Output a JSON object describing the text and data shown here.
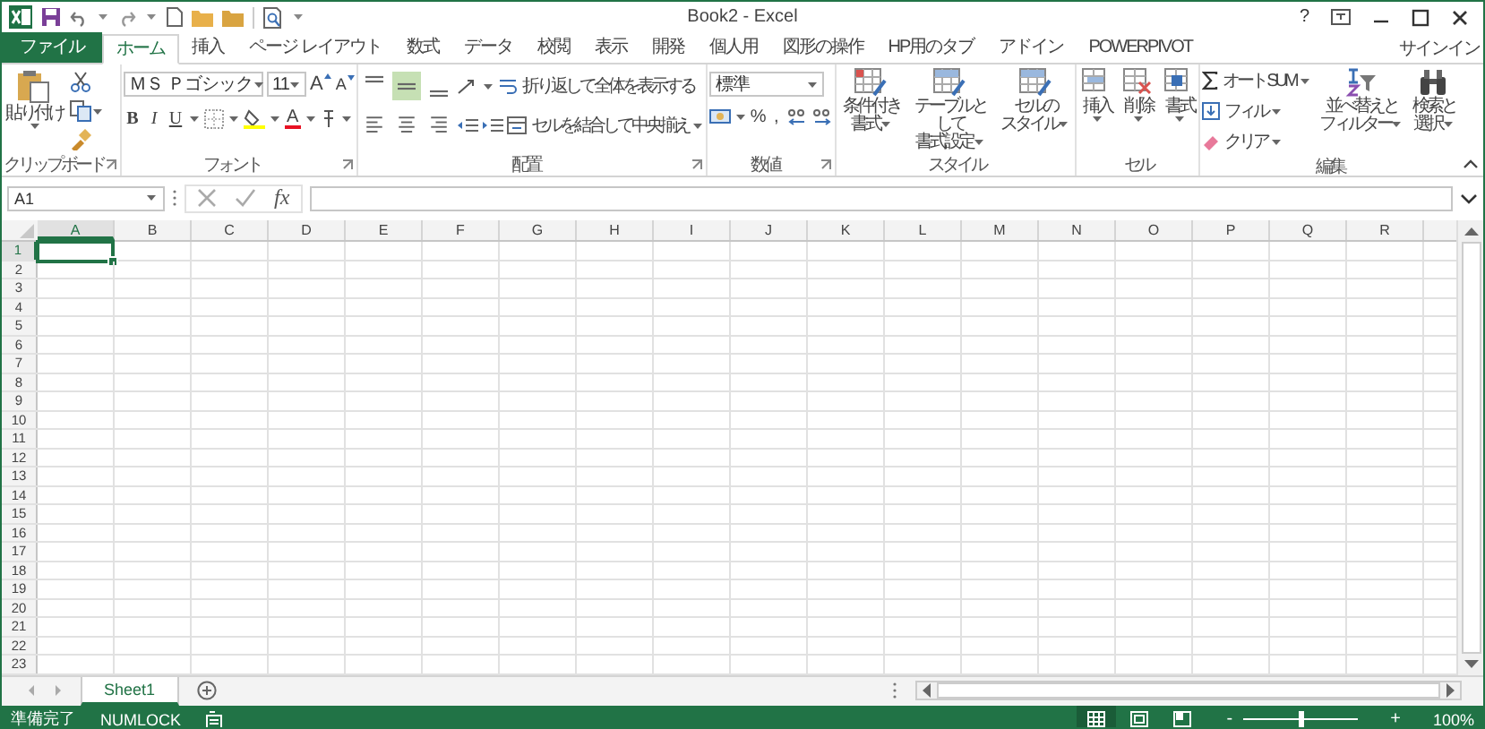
{
  "window": {
    "title": "Book2 - Excel",
    "help": "?"
  },
  "tabs": [
    {
      "label": "ファイル",
      "kind": "file",
      "selected": false
    },
    {
      "label": "ホーム",
      "kind": "tab",
      "selected": true
    },
    {
      "label": "挿入",
      "kind": "tab",
      "selected": false
    },
    {
      "label": "ページ レイアウト",
      "kind": "tab",
      "selected": false
    },
    {
      "label": "数式",
      "kind": "tab",
      "selected": false
    },
    {
      "label": "データ",
      "kind": "tab",
      "selected": false
    },
    {
      "label": "校閲",
      "kind": "tab",
      "selected": false
    },
    {
      "label": "表示",
      "kind": "tab",
      "selected": false
    },
    {
      "label": "開発",
      "kind": "tab",
      "selected": false
    },
    {
      "label": "個人用",
      "kind": "tab",
      "selected": false
    },
    {
      "label": "図形の操作",
      "kind": "tab",
      "selected": false
    },
    {
      "label": "HP用のタブ",
      "kind": "tab",
      "selected": false
    },
    {
      "label": "アドイン",
      "kind": "tab",
      "selected": false
    },
    {
      "label": "POWERPIVOT",
      "kind": "tab",
      "selected": false
    }
  ],
  "account": "サインイン",
  "ribbon": {
    "clipboard": {
      "label": "クリップボード",
      "paste": "貼り付け"
    },
    "font": {
      "label": "フォント",
      "font_name": "ＭＳ Ｐゴシック",
      "font_size": "11",
      "grow": "A",
      "shrink": "A",
      "styles": [
        {
          "label": "B",
          "kind": "bold"
        },
        {
          "label": "I",
          "kind": "italic"
        },
        {
          "label": "U",
          "kind": "underline"
        }
      ],
      "font_color": "A"
    },
    "alignment": {
      "label": "配置",
      "vertical": [
        {
          "kind": "top",
          "selected": false
        },
        {
          "kind": "middle",
          "selected": true
        },
        {
          "kind": "bottom",
          "selected": false
        }
      ],
      "horizontal": [
        {
          "kind": "left",
          "selected": false
        },
        {
          "kind": "center",
          "selected": false
        },
        {
          "kind": "right",
          "selected": false
        }
      ],
      "wrap": "折り返して全体を表示する",
      "merge": "セルを結合して中央揃え"
    },
    "number": {
      "label": "数値",
      "format": "標準",
      "percent": "%",
      "comma": ","
    },
    "styles": {
      "label": "スタイル",
      "buttons": [
        [
          "条件付き",
          "書式"
        ],
        [
          "テーブルとして",
          "書式設定"
        ],
        [
          "セルの",
          "スタイル"
        ]
      ]
    },
    "cells": {
      "label": "セル",
      "buttons": [
        "挿入",
        "削除",
        "書式"
      ]
    },
    "editing": {
      "label": "編集",
      "autosum": "オート SUM",
      "fill": "フィル",
      "clear": "クリア",
      "buttons": [
        [
          "並べ替えと",
          "フィルター"
        ],
        [
          "検索と",
          "選択"
        ]
      ]
    }
  },
  "formula_bar": {
    "name_box": "A1",
    "function_label": "fx"
  },
  "columns": [
    {
      "label": "A",
      "selected": true
    },
    {
      "label": "B",
      "selected": false
    },
    {
      "label": "C",
      "selected": false
    },
    {
      "label": "D",
      "selected": false
    },
    {
      "label": "E",
      "selected": false
    },
    {
      "label": "F",
      "selected": false
    },
    {
      "label": "G",
      "selected": false
    },
    {
      "label": "H",
      "selected": false
    },
    {
      "label": "I",
      "selected": false
    },
    {
      "label": "J",
      "selected": false
    },
    {
      "label": "K",
      "selected": false
    },
    {
      "label": "L",
      "selected": false
    },
    {
      "label": "M",
      "selected": false
    },
    {
      "label": "N",
      "selected": false
    },
    {
      "label": "O",
      "selected": false
    },
    {
      "label": "P",
      "selected": false
    },
    {
      "label": "Q",
      "selected": false
    },
    {
      "label": "R",
      "selected": false
    }
  ],
  "rows": [
    {
      "label": "1",
      "selected": true
    },
    {
      "label": "2",
      "selected": false
    },
    {
      "label": "3",
      "selected": false
    },
    {
      "label": "4",
      "selected": false
    },
    {
      "label": "5",
      "selected": false
    },
    {
      "label": "6",
      "selected": false
    },
    {
      "label": "7",
      "selected": false
    },
    {
      "label": "8",
      "selected": false
    },
    {
      "label": "9",
      "selected": false
    },
    {
      "label": "10",
      "selected": false
    },
    {
      "label": "11",
      "selected": false
    },
    {
      "label": "12",
      "selected": false
    },
    {
      "label": "13",
      "selected": false
    },
    {
      "label": "14",
      "selected": false
    },
    {
      "label": "15",
      "selected": false
    },
    {
      "label": "16",
      "selected": false
    },
    {
      "label": "17",
      "selected": false
    },
    {
      "label": "18",
      "selected": false
    },
    {
      "label": "19",
      "selected": false
    },
    {
      "label": "20",
      "selected": false
    },
    {
      "label": "21",
      "selected": false
    },
    {
      "label": "22",
      "selected": false
    },
    {
      "label": "23",
      "selected": false
    }
  ],
  "sheets": [
    {
      "label": "Sheet1",
      "selected": true
    }
  ],
  "status_bar": {
    "status": "準備完了",
    "numlock": "NUMLOCK",
    "views": [
      {
        "kind": "normal",
        "selected": true
      },
      {
        "kind": "page_layout",
        "selected": false
      },
      {
        "kind": "page_break",
        "selected": false
      }
    ],
    "zoom_out": "-",
    "zoom_in": "+",
    "zoom": {
      "level": 0.5
    },
    "zoom_text": "100%"
  }
}
